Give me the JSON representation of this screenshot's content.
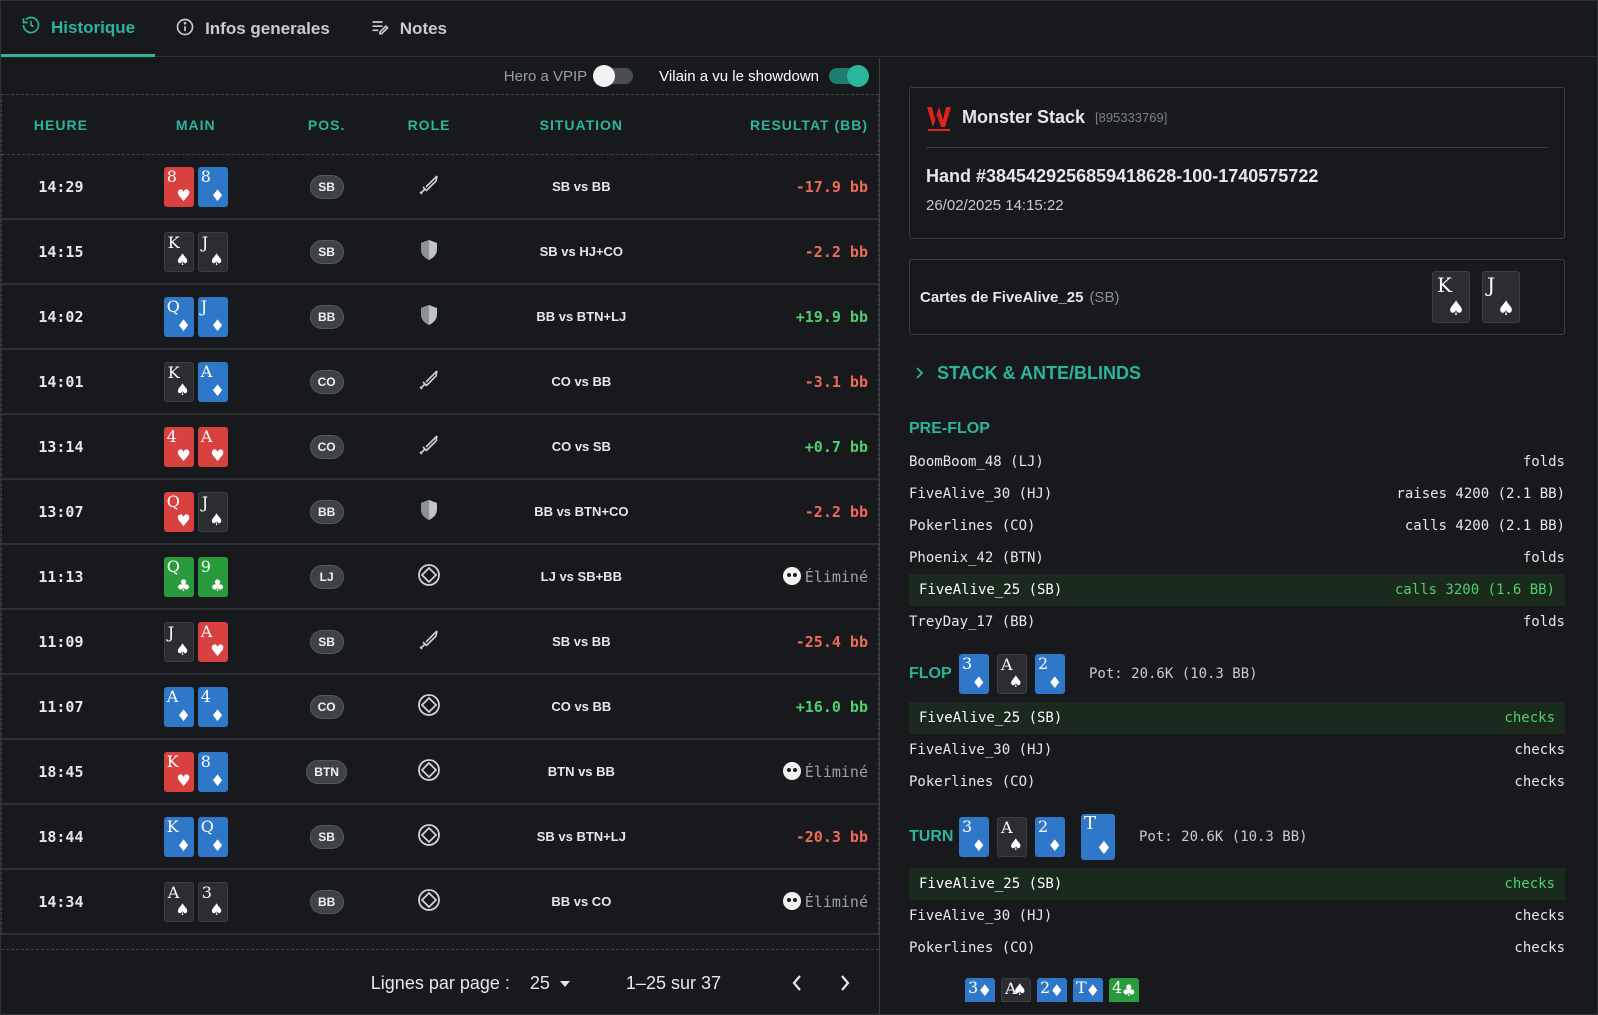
{
  "tabs": [
    {
      "label": "Historique",
      "icon": "history-icon"
    },
    {
      "label": "Infos generales",
      "icon": "info-icon"
    },
    {
      "label": "Notes",
      "icon": "notes-icon"
    }
  ],
  "toggles": {
    "vpip_label": "Hero a VPIP",
    "vpip_on": false,
    "showdown_label": "Vilain a vu le showdown",
    "showdown_on": true
  },
  "table": {
    "headers": [
      "HEURE",
      "MAIN",
      "POS.",
      "ROLE",
      "SITUATION",
      "RESULTAT (BB)"
    ],
    "rows": [
      {
        "time": "14:29",
        "cards": [
          [
            "8",
            "h"
          ],
          [
            "8",
            "d"
          ]
        ],
        "pos": "SB",
        "role": "sword-icon",
        "situation": "SB vs BB",
        "result": "-17.9 bb",
        "kind": "neg"
      },
      {
        "time": "14:15",
        "cards": [
          [
            "K",
            "s"
          ],
          [
            "J",
            "s"
          ]
        ],
        "pos": "SB",
        "role": "shield-icon",
        "situation": "SB vs HJ+CO",
        "result": "-2.2 bb",
        "kind": "neg"
      },
      {
        "time": "14:02",
        "cards": [
          [
            "Q",
            "d"
          ],
          [
            "J",
            "d"
          ]
        ],
        "pos": "BB",
        "role": "shield-icon",
        "situation": "BB vs BTN+LJ",
        "result": "+19.9 bb",
        "kind": "pos"
      },
      {
        "time": "14:01",
        "cards": [
          [
            "K",
            "s"
          ],
          [
            "A",
            "d"
          ]
        ],
        "pos": "CO",
        "role": "sword-icon",
        "situation": "CO vs BB",
        "result": "-3.1 bb",
        "kind": "neg"
      },
      {
        "time": "13:14",
        "cards": [
          [
            "4",
            "h"
          ],
          [
            "A",
            "h"
          ]
        ],
        "pos": "CO",
        "role": "sword-icon",
        "situation": "CO vs SB",
        "result": "+0.7 bb",
        "kind": "pos"
      },
      {
        "time": "13:07",
        "cards": [
          [
            "Q",
            "h"
          ],
          [
            "J",
            "s"
          ]
        ],
        "pos": "BB",
        "role": "shield-icon",
        "situation": "BB vs BTN+CO",
        "result": "-2.2 bb",
        "kind": "neg"
      },
      {
        "time": "11:13",
        "cards": [
          [
            "Q",
            "c"
          ],
          [
            "9",
            "c"
          ]
        ],
        "pos": "LJ",
        "role": "target-icon",
        "situation": "LJ vs SB+BB",
        "result": "Éliminé",
        "kind": "elim"
      },
      {
        "time": "11:09",
        "cards": [
          [
            "J",
            "s"
          ],
          [
            "A",
            "h"
          ]
        ],
        "pos": "SB",
        "role": "sword-icon",
        "situation": "SB vs BB",
        "result": "-25.4 bb",
        "kind": "neg"
      },
      {
        "time": "11:07",
        "cards": [
          [
            "A",
            "d"
          ],
          [
            "4",
            "d"
          ]
        ],
        "pos": "CO",
        "role": "target-icon",
        "situation": "CO vs BB",
        "result": "+16.0 bb",
        "kind": "pos"
      },
      {
        "time": "18:45",
        "cards": [
          [
            "K",
            "h"
          ],
          [
            "8",
            "d"
          ]
        ],
        "pos": "BTN",
        "role": "target-icon",
        "situation": "BTN vs BB",
        "result": "Éliminé",
        "kind": "elim"
      },
      {
        "time": "18:44",
        "cards": [
          [
            "K",
            "d"
          ],
          [
            "Q",
            "d"
          ]
        ],
        "pos": "SB",
        "role": "target-icon",
        "situation": "SB vs BTN+LJ",
        "result": "-20.3 bb",
        "kind": "neg"
      },
      {
        "time": "14:34",
        "cards": [
          [
            "A",
            "s"
          ],
          [
            "3",
            "s"
          ]
        ],
        "pos": "BB",
        "role": "target-icon",
        "situation": "BB vs CO",
        "result": "Éliminé",
        "kind": "elim"
      }
    ]
  },
  "pager": {
    "rows_label": "Lignes par page :",
    "rows_value": "25",
    "range": "1–25 sur 37"
  },
  "detail": {
    "tournament": "Monster Stack",
    "tournament_id": "[895333769]",
    "hand": "Hand #3845429256859418628-100-1740575722",
    "date": "26/02/2025 14:15:22",
    "cards_label": "Cartes de FiveAlive_25",
    "cards_pos": "(SB)",
    "hero_cards": [
      [
        "K",
        "s"
      ],
      [
        "J",
        "s"
      ]
    ],
    "stack_label": "STACK & ANTE/BLINDS",
    "preflop_title": "PRE-FLOP",
    "preflop": [
      {
        "player": "BoomBoom_48 (LJ)",
        "action": "folds",
        "hero": false
      },
      {
        "player": "FiveAlive_30 (HJ)",
        "action": "raises 4200 (2.1 BB)",
        "hero": false
      },
      {
        "player": "Pokerlines (CO)",
        "action": "calls 4200 (2.1 BB)",
        "hero": false
      },
      {
        "player": "Phoenix_42 (BTN)",
        "action": "folds",
        "hero": false
      },
      {
        "player": "FiveAlive_25 (SB)",
        "action": "calls 3200 (1.6 BB)",
        "hero": true
      },
      {
        "player": "TreyDay_17 (BB)",
        "action": "folds",
        "hero": false
      }
    ],
    "flop_title": "FLOP",
    "flop_cards": [
      [
        "3",
        "d"
      ],
      [
        "A",
        "s"
      ],
      [
        "2",
        "d"
      ]
    ],
    "flop_pot": "Pot: 20.6K (10.3 BB)",
    "flop": [
      {
        "player": "FiveAlive_25 (SB)",
        "action": "checks",
        "hero": true
      },
      {
        "player": "FiveAlive_30 (HJ)",
        "action": "checks",
        "hero": false
      },
      {
        "player": "Pokerlines (CO)",
        "action": "checks",
        "hero": false
      }
    ],
    "turn_title": "TURN",
    "turn_cards": [
      [
        "3",
        "d"
      ],
      [
        "A",
        "s"
      ],
      [
        "2",
        "d"
      ]
    ],
    "turn_card": [
      "T",
      "d"
    ],
    "turn_pot": "Pot: 20.6K (10.3 BB)",
    "turn": [
      {
        "player": "FiveAlive_25 (SB)",
        "action": "checks",
        "hero": true
      },
      {
        "player": "FiveAlive_30 (HJ)",
        "action": "checks",
        "hero": false
      },
      {
        "player": "Pokerlines (CO)",
        "action": "checks",
        "hero": false
      }
    ],
    "river_cards": [
      [
        "3",
        "d"
      ],
      [
        "A",
        "s"
      ],
      [
        "2",
        "d"
      ],
      [
        "T",
        "d"
      ],
      [
        "4",
        "c"
      ]
    ]
  },
  "colors": {
    "accent": "#2bb59b",
    "negative": "#f06b57",
    "positive": "#4fd06c",
    "hearts": "#d8413f",
    "diamonds": "#2f78c9",
    "clubs": "#2a9b3c",
    "spades": "#2b2d31"
  }
}
